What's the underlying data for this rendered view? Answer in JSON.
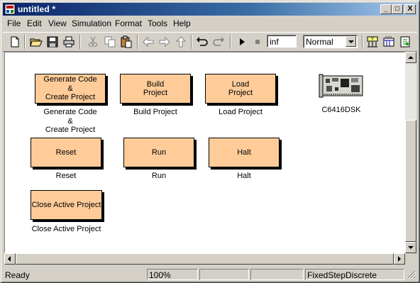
{
  "window": {
    "title": "untitled *"
  },
  "title_buttons": {
    "minimize": "_",
    "maximize": "□",
    "close": "X"
  },
  "menu": [
    {
      "label": "File"
    },
    {
      "label": "Edit"
    },
    {
      "label": "View"
    },
    {
      "label": "Simulation"
    },
    {
      "label": "Format"
    },
    {
      "label": "Tools"
    },
    {
      "label": "Help"
    }
  ],
  "toolbar": {
    "stop_time": "inf",
    "sim_mode": "Normal",
    "icons": [
      "new-model-icon",
      "open-icon",
      "save-icon",
      "print-icon",
      "cut-icon",
      "copy-icon",
      "paste-icon",
      "back-icon",
      "forward-icon",
      "up-icon",
      "undo-icon",
      "redo-icon",
      "start-icon",
      "stop-icon",
      "library-browser-icon",
      "model-explorer-icon",
      "debug-icon"
    ]
  },
  "blocks": {
    "generate": {
      "text": "Generate Code\n&\nCreate Project",
      "label": "Generate Code\n&\nCreate Project"
    },
    "build": {
      "text": "Build\nProject",
      "label": "Build Project"
    },
    "load": {
      "text": "Load\nProject",
      "label": "Load Project"
    },
    "reset": {
      "text": "Reset",
      "label": "Reset"
    },
    "run": {
      "text": "Run",
      "label": "Run"
    },
    "halt": {
      "text": "Halt",
      "label": "Halt"
    },
    "close": {
      "text": "Close Active Project",
      "label": "Close Active Project"
    },
    "dsk": {
      "label": "C6416DSK"
    }
  },
  "status": {
    "state": "Ready",
    "zoom": "100%",
    "solver": "FixedStepDiscrete"
  }
}
